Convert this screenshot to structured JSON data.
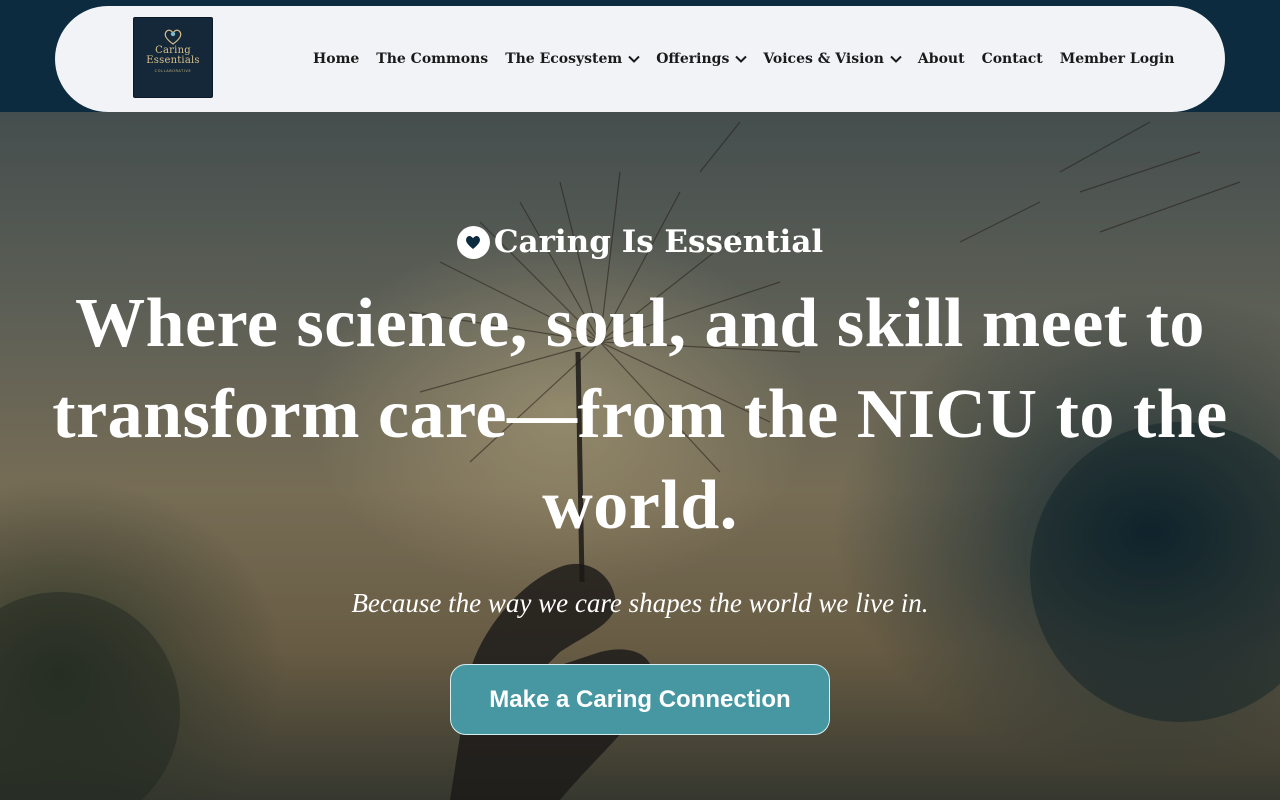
{
  "brand": {
    "logo_line1": "Caring",
    "logo_line2": "Essentials",
    "logo_sub": "COLLABORATIVE",
    "colors": {
      "navy": "#0d2b3e",
      "teal": "#4797a3",
      "pill": "#f1f3f6",
      "gold": "#d9c08a"
    }
  },
  "nav": {
    "items": [
      {
        "label": "Home",
        "dropdown": false
      },
      {
        "label": "The Commons",
        "dropdown": false
      },
      {
        "label": "The Ecosystem",
        "dropdown": true
      },
      {
        "label": "Offerings",
        "dropdown": true
      },
      {
        "label": "Voices & Vision",
        "dropdown": true
      },
      {
        "label": "About",
        "dropdown": false
      },
      {
        "label": "Contact",
        "dropdown": false
      },
      {
        "label": "Member Login",
        "dropdown": false
      }
    ]
  },
  "hero": {
    "tagline": "Caring Is Essential",
    "tagline_icon": "heart-icon",
    "headline": "Where science, soul, and skill meet to transform care—from the NICU to the world.",
    "subheadline": "Because the way we care shapes the world we live in.",
    "cta_label": "Make a Caring Connection"
  }
}
